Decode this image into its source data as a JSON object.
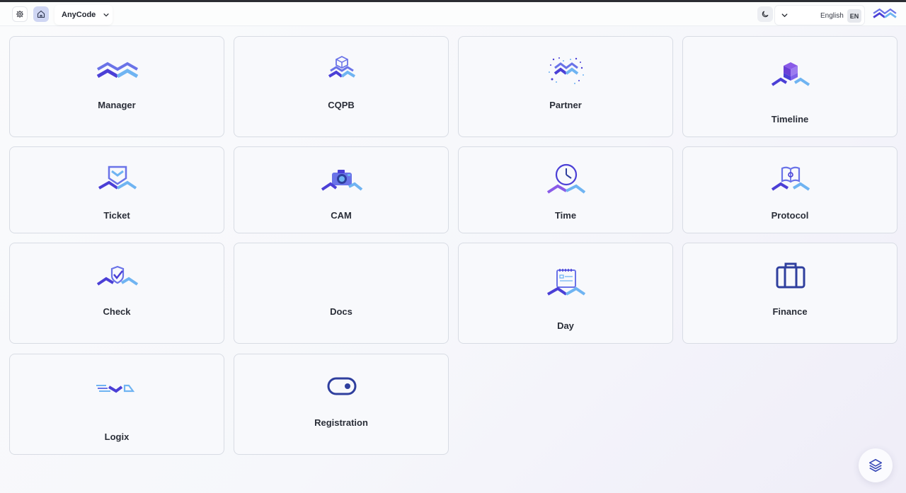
{
  "header": {
    "app_selector": "AnyCode",
    "language_label": "English",
    "language_code": "EN"
  },
  "apps": [
    {
      "label": "Manager"
    },
    {
      "label": "CQPB"
    },
    {
      "label": "Partner"
    },
    {
      "label": "Timeline"
    },
    {
      "label": "Ticket"
    },
    {
      "label": "CAM"
    },
    {
      "label": "Time"
    },
    {
      "label": "Protocol"
    },
    {
      "label": "Check"
    },
    {
      "label": "Docs"
    },
    {
      "label": "Day"
    },
    {
      "label": "Finance"
    },
    {
      "label": "Logix"
    },
    {
      "label": "Registration"
    }
  ],
  "icons": {
    "settings": "gear-icon",
    "home": "home-icon",
    "theme": "moon-icon",
    "language_dropdown": "chevron-down-icon",
    "brand": "brand-logo-icon",
    "fab": "layers-icon"
  },
  "colors": {
    "accent_dark": "#4b3fd6",
    "accent_mid": "#6a73e8",
    "accent_light": "#6fb4f2",
    "finance_navy": "#2f3f9e"
  }
}
